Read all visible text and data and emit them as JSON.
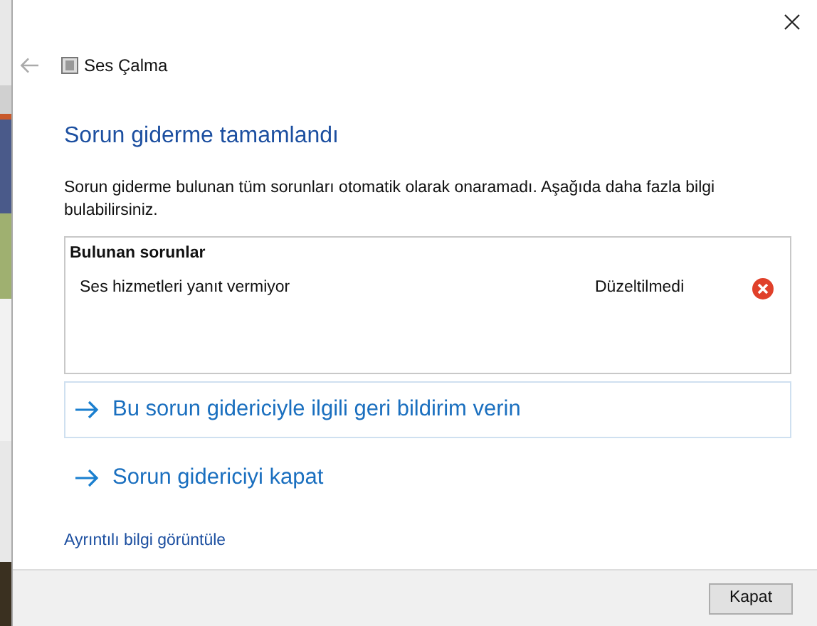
{
  "window": {
    "title": "Ses Çalma"
  },
  "heading": "Sorun giderme tamamlandı",
  "description": "Sorun giderme bulunan tüm sorunları otomatik olarak onaramadı. Aşağıda daha fazla bilgi bulabilirsiniz.",
  "problems": {
    "title": "Bulunan sorunlar",
    "items": [
      {
        "name": "Ses hizmetleri yanıt vermiyor",
        "status": "Düzeltilmedi",
        "fixed": false
      }
    ]
  },
  "actions": [
    {
      "label": "Bu sorun gidericiyle ilgili geri bildirim verin",
      "selected": true
    },
    {
      "label": "Sorun gidericiyi kapat",
      "selected": false
    }
  ],
  "details_link": "Ayrıntılı bilgi görüntüle",
  "buttons": [
    "Kapat"
  ]
}
